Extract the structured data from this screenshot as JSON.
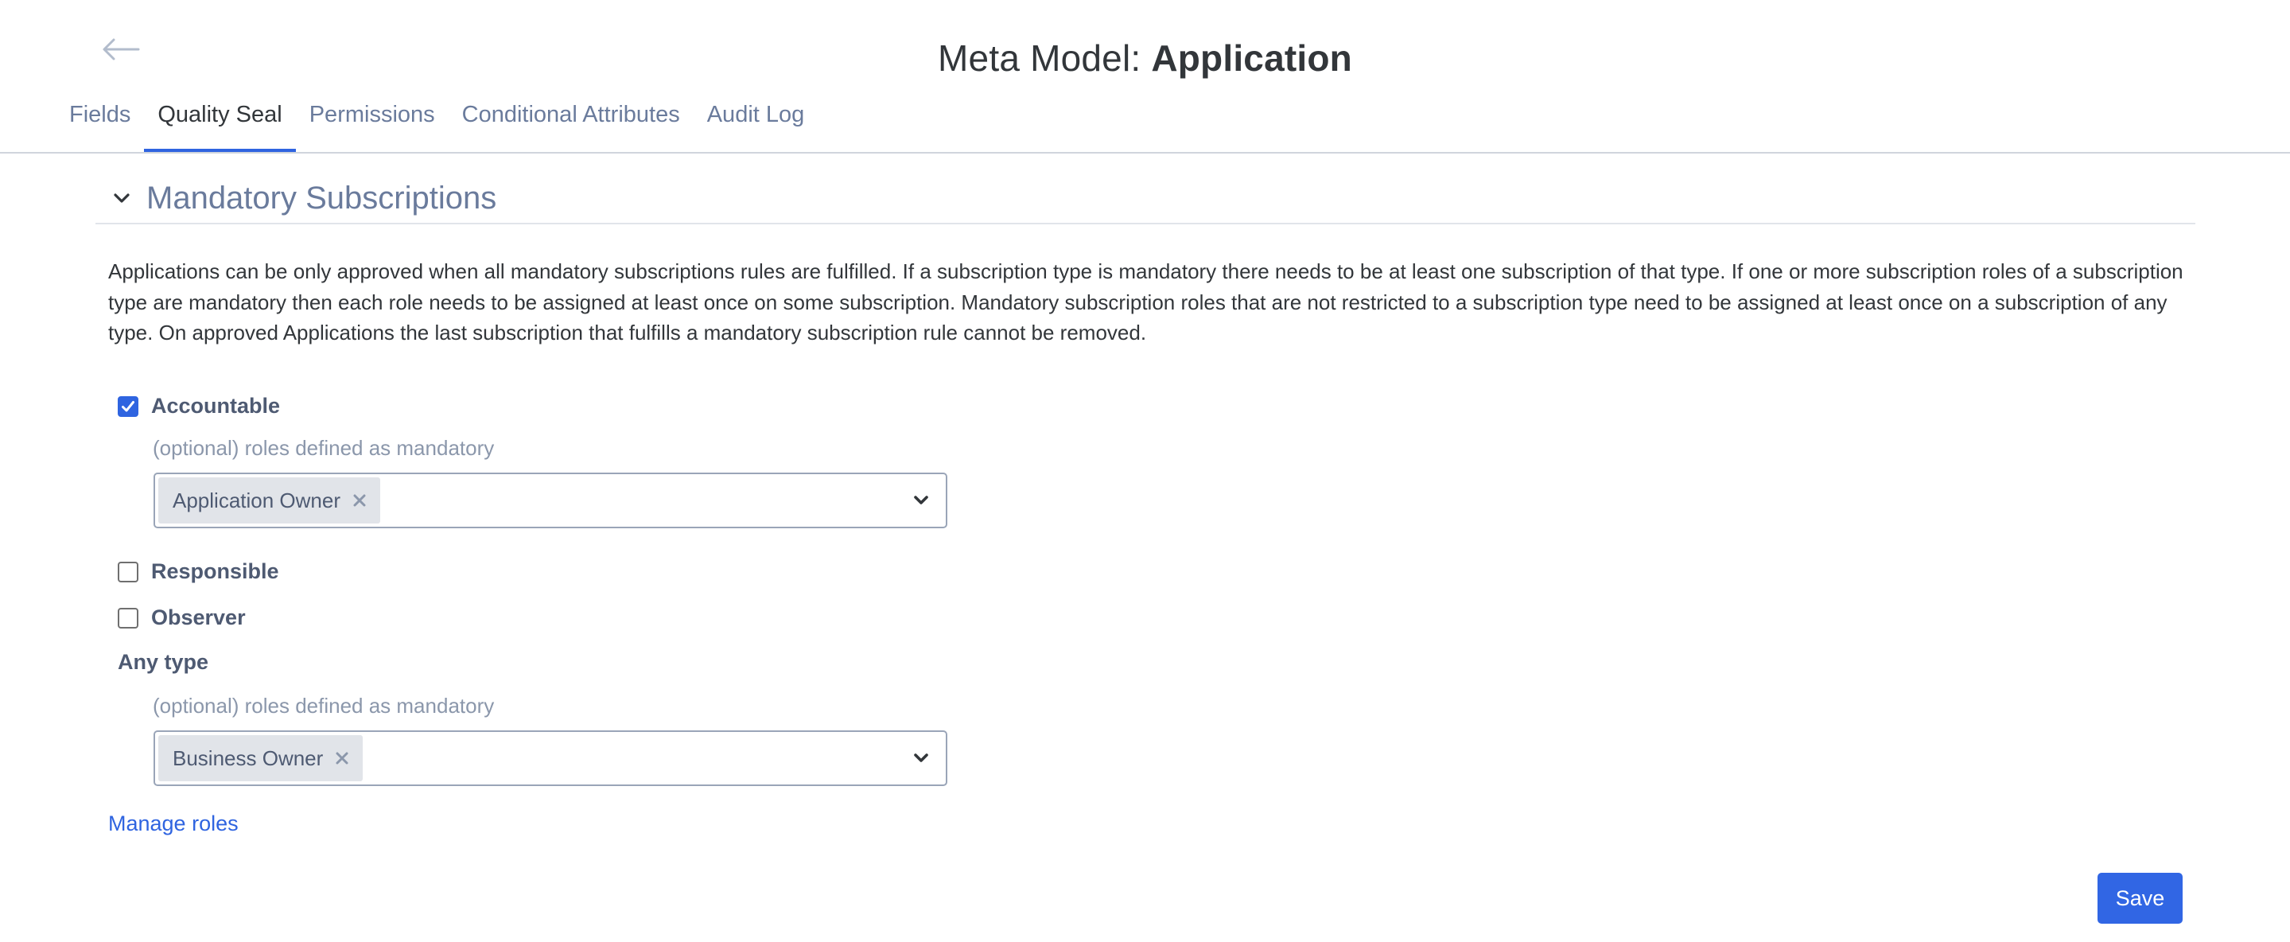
{
  "header": {
    "back_icon": "arrow-left-icon",
    "title_prefix": "Meta Model: ",
    "title_entity": "Application"
  },
  "tabs": [
    {
      "label": "Fields",
      "active": false
    },
    {
      "label": "Quality Seal",
      "active": true
    },
    {
      "label": "Permissions",
      "active": false
    },
    {
      "label": "Conditional Attributes",
      "active": false
    },
    {
      "label": "Audit Log",
      "active": false
    }
  ],
  "section": {
    "title": "Mandatory Subscriptions",
    "expanded": true,
    "chevron_icon": "chevron-down-icon",
    "description": "Applications can be only approved when all mandatory subscriptions rules are fulfilled. If a subscription type is mandatory there needs to be at least one subscription of that type. If one or more subscription roles of a subscription type are mandatory then each role needs to be assigned at least once on some subscription. Mandatory subscription roles that are not restricted to a subscription type need to be assigned at least once on a subscription of any type. On approved Applications the last subscription that fulfills a mandatory subscription rule cannot be removed."
  },
  "subscription_types": [
    {
      "label": "Accountable",
      "checked": true,
      "roles_hint": "(optional) roles defined as mandatory",
      "selected_roles": [
        "Application Owner"
      ]
    },
    {
      "label": "Responsible",
      "checked": false
    },
    {
      "label": "Observer",
      "checked": false
    }
  ],
  "any_type": {
    "label": "Any type",
    "roles_hint": "(optional) roles defined as mandatory",
    "selected_roles": [
      "Business Owner"
    ]
  },
  "links": {
    "manage_roles": "Manage roles"
  },
  "actions": {
    "save_label": "Save"
  },
  "colors": {
    "accent": "#2f64e0",
    "tab_inactive": "#6a7b9c",
    "text": "#32363a",
    "chip_bg": "#e1e4e9"
  }
}
